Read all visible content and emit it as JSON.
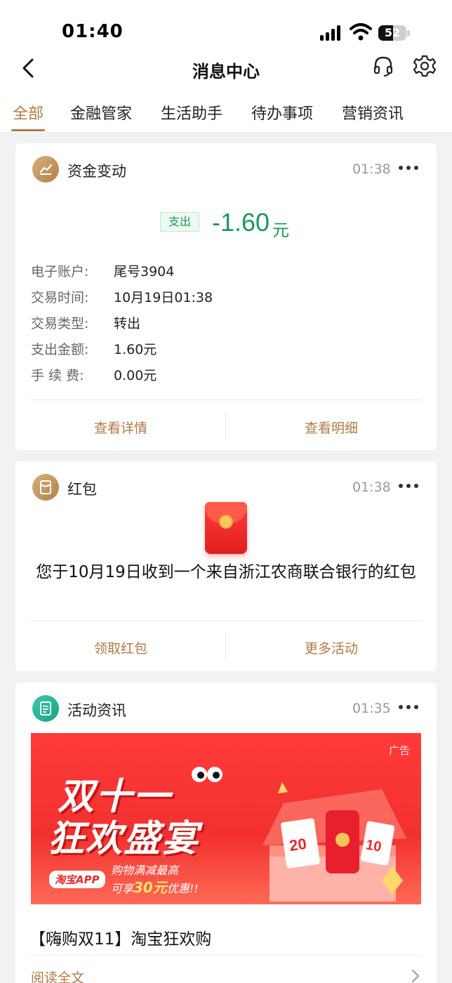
{
  "status_bar": {
    "time": "01:40",
    "battery": "52",
    "battery_level": 0.52
  },
  "nav": {
    "title": "消息中心",
    "icons": [
      "back-chevron-icon",
      "headset-icon",
      "gear-icon"
    ]
  },
  "tabs": [
    {
      "label": "全部",
      "active": true
    },
    {
      "label": "金融管家",
      "active": false
    },
    {
      "label": "生活助手",
      "active": false
    },
    {
      "label": "待办事项",
      "active": false
    },
    {
      "label": "营销资讯",
      "active": false
    }
  ],
  "fund_card": {
    "title": "资金变动",
    "time": "01:38",
    "badge": "支出",
    "amount": "-1.60",
    "amount_unit": "元",
    "rows": [
      {
        "label": "电子账户:",
        "value": "尾号3904"
      },
      {
        "label": "交易时间:",
        "value": "10月19日01:38"
      },
      {
        "label": "交易类型:",
        "value": "转出"
      },
      {
        "label": "支出金额:",
        "value": "1.60元"
      },
      {
        "label": "手 续 费:",
        "value": "0.00元"
      }
    ],
    "actions": [
      "查看详情",
      "查看明细"
    ]
  },
  "redpacket_card": {
    "title": "红包",
    "time": "01:38",
    "text": "您于10月19日收到一个来自浙江农商联合银行的红包",
    "actions": [
      "领取红包",
      "更多活动"
    ]
  },
  "activity_card": {
    "title": "活动资讯",
    "time": "01:35",
    "banner": {
      "ad_tag": "广告",
      "line1": "双十一",
      "line2": "狂欢盛宴",
      "app_badge": "淘宝APP",
      "promo_line1": "购物满减最高",
      "promo_line2_prefix": "可享",
      "promo_highlight": "30元",
      "promo_line2_suffix": "优惠!!"
    },
    "article_title": "【嗨购双11】淘宝狂欢购",
    "read_more": "阅读全文"
  },
  "colors": {
    "accent": "#b07a46",
    "expense_green": "#1a9a58",
    "banner_red": "#f23030"
  }
}
